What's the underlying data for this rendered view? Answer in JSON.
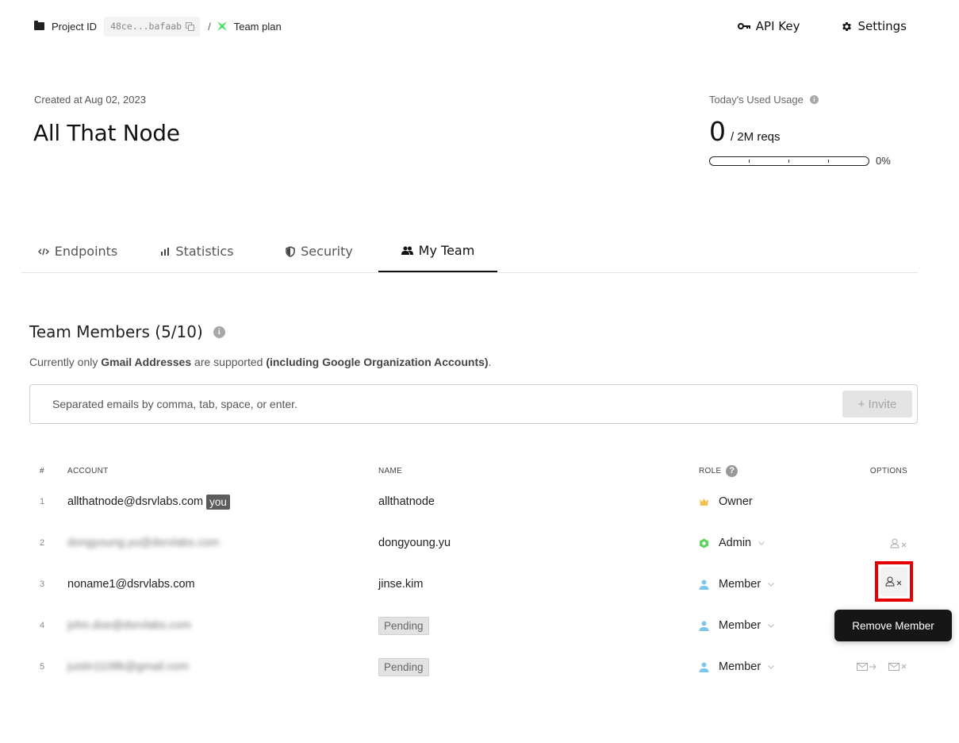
{
  "breadcrumb": {
    "project_label": "Project ID",
    "project_id": "48ce...bafaab",
    "separator": "/",
    "plan": "Team plan"
  },
  "top_actions": {
    "api_key": "API Key",
    "settings": "Settings"
  },
  "project": {
    "created": "Created at Aug 02, 2023",
    "title": "All That Node"
  },
  "usage": {
    "label": "Today's Used Usage",
    "value": "0",
    "unit": "/ 2M reqs",
    "percent_label": "0%",
    "percent": 0
  },
  "tabs": [
    {
      "label": "Endpoints",
      "icon": "code-icon",
      "active": false
    },
    {
      "label": "Statistics",
      "icon": "bar-chart-icon",
      "active": false
    },
    {
      "label": "Security",
      "icon": "shield-icon",
      "active": false
    },
    {
      "label": "My Team",
      "icon": "people-icon",
      "active": true
    }
  ],
  "team": {
    "title": "Team Members (5/10)",
    "note_prefix": "Currently only ",
    "note_bold1": "Gmail Addresses",
    "note_mid": " are supported ",
    "note_bold2": "(including Google Organization Accounts)",
    "note_suffix": ".",
    "invite_placeholder": "Separated emails by comma, tab, space, or enter.",
    "invite_button": "+  Invite"
  },
  "table": {
    "headers": {
      "num": "#",
      "account": "ACCOUNT",
      "name": "NAME",
      "role": "ROLE",
      "options": "OPTIONS"
    },
    "rows": [
      {
        "num": "1",
        "account": "allthatnode@dsrvlabs.com",
        "you": "you",
        "name": "allthatnode",
        "role": "Owner",
        "role_color": "#f2c14e"
      },
      {
        "num": "2",
        "account": "dongyoung.yu@dsrvlabs.com",
        "blurred": true,
        "name": "dongyoung.yu",
        "role": "Admin",
        "role_color": "#5fd35f"
      },
      {
        "num": "3",
        "account": "noname1@dsrvlabs.com",
        "name": "jinse.kim",
        "role": "Member",
        "role_color": "#7cc6ec"
      },
      {
        "num": "4",
        "account": "john.doe@dsrvlabs.com",
        "blurred": true,
        "name": "Pending",
        "pending": true,
        "role": "Member",
        "role_color": "#7cc6ec"
      },
      {
        "num": "5",
        "account": "justin1108k@gmail.com",
        "blurred": true,
        "name": "Pending",
        "pending": true,
        "role": "Member",
        "role_color": "#7cc6ec"
      }
    ]
  },
  "tooltip": "Remove Member"
}
